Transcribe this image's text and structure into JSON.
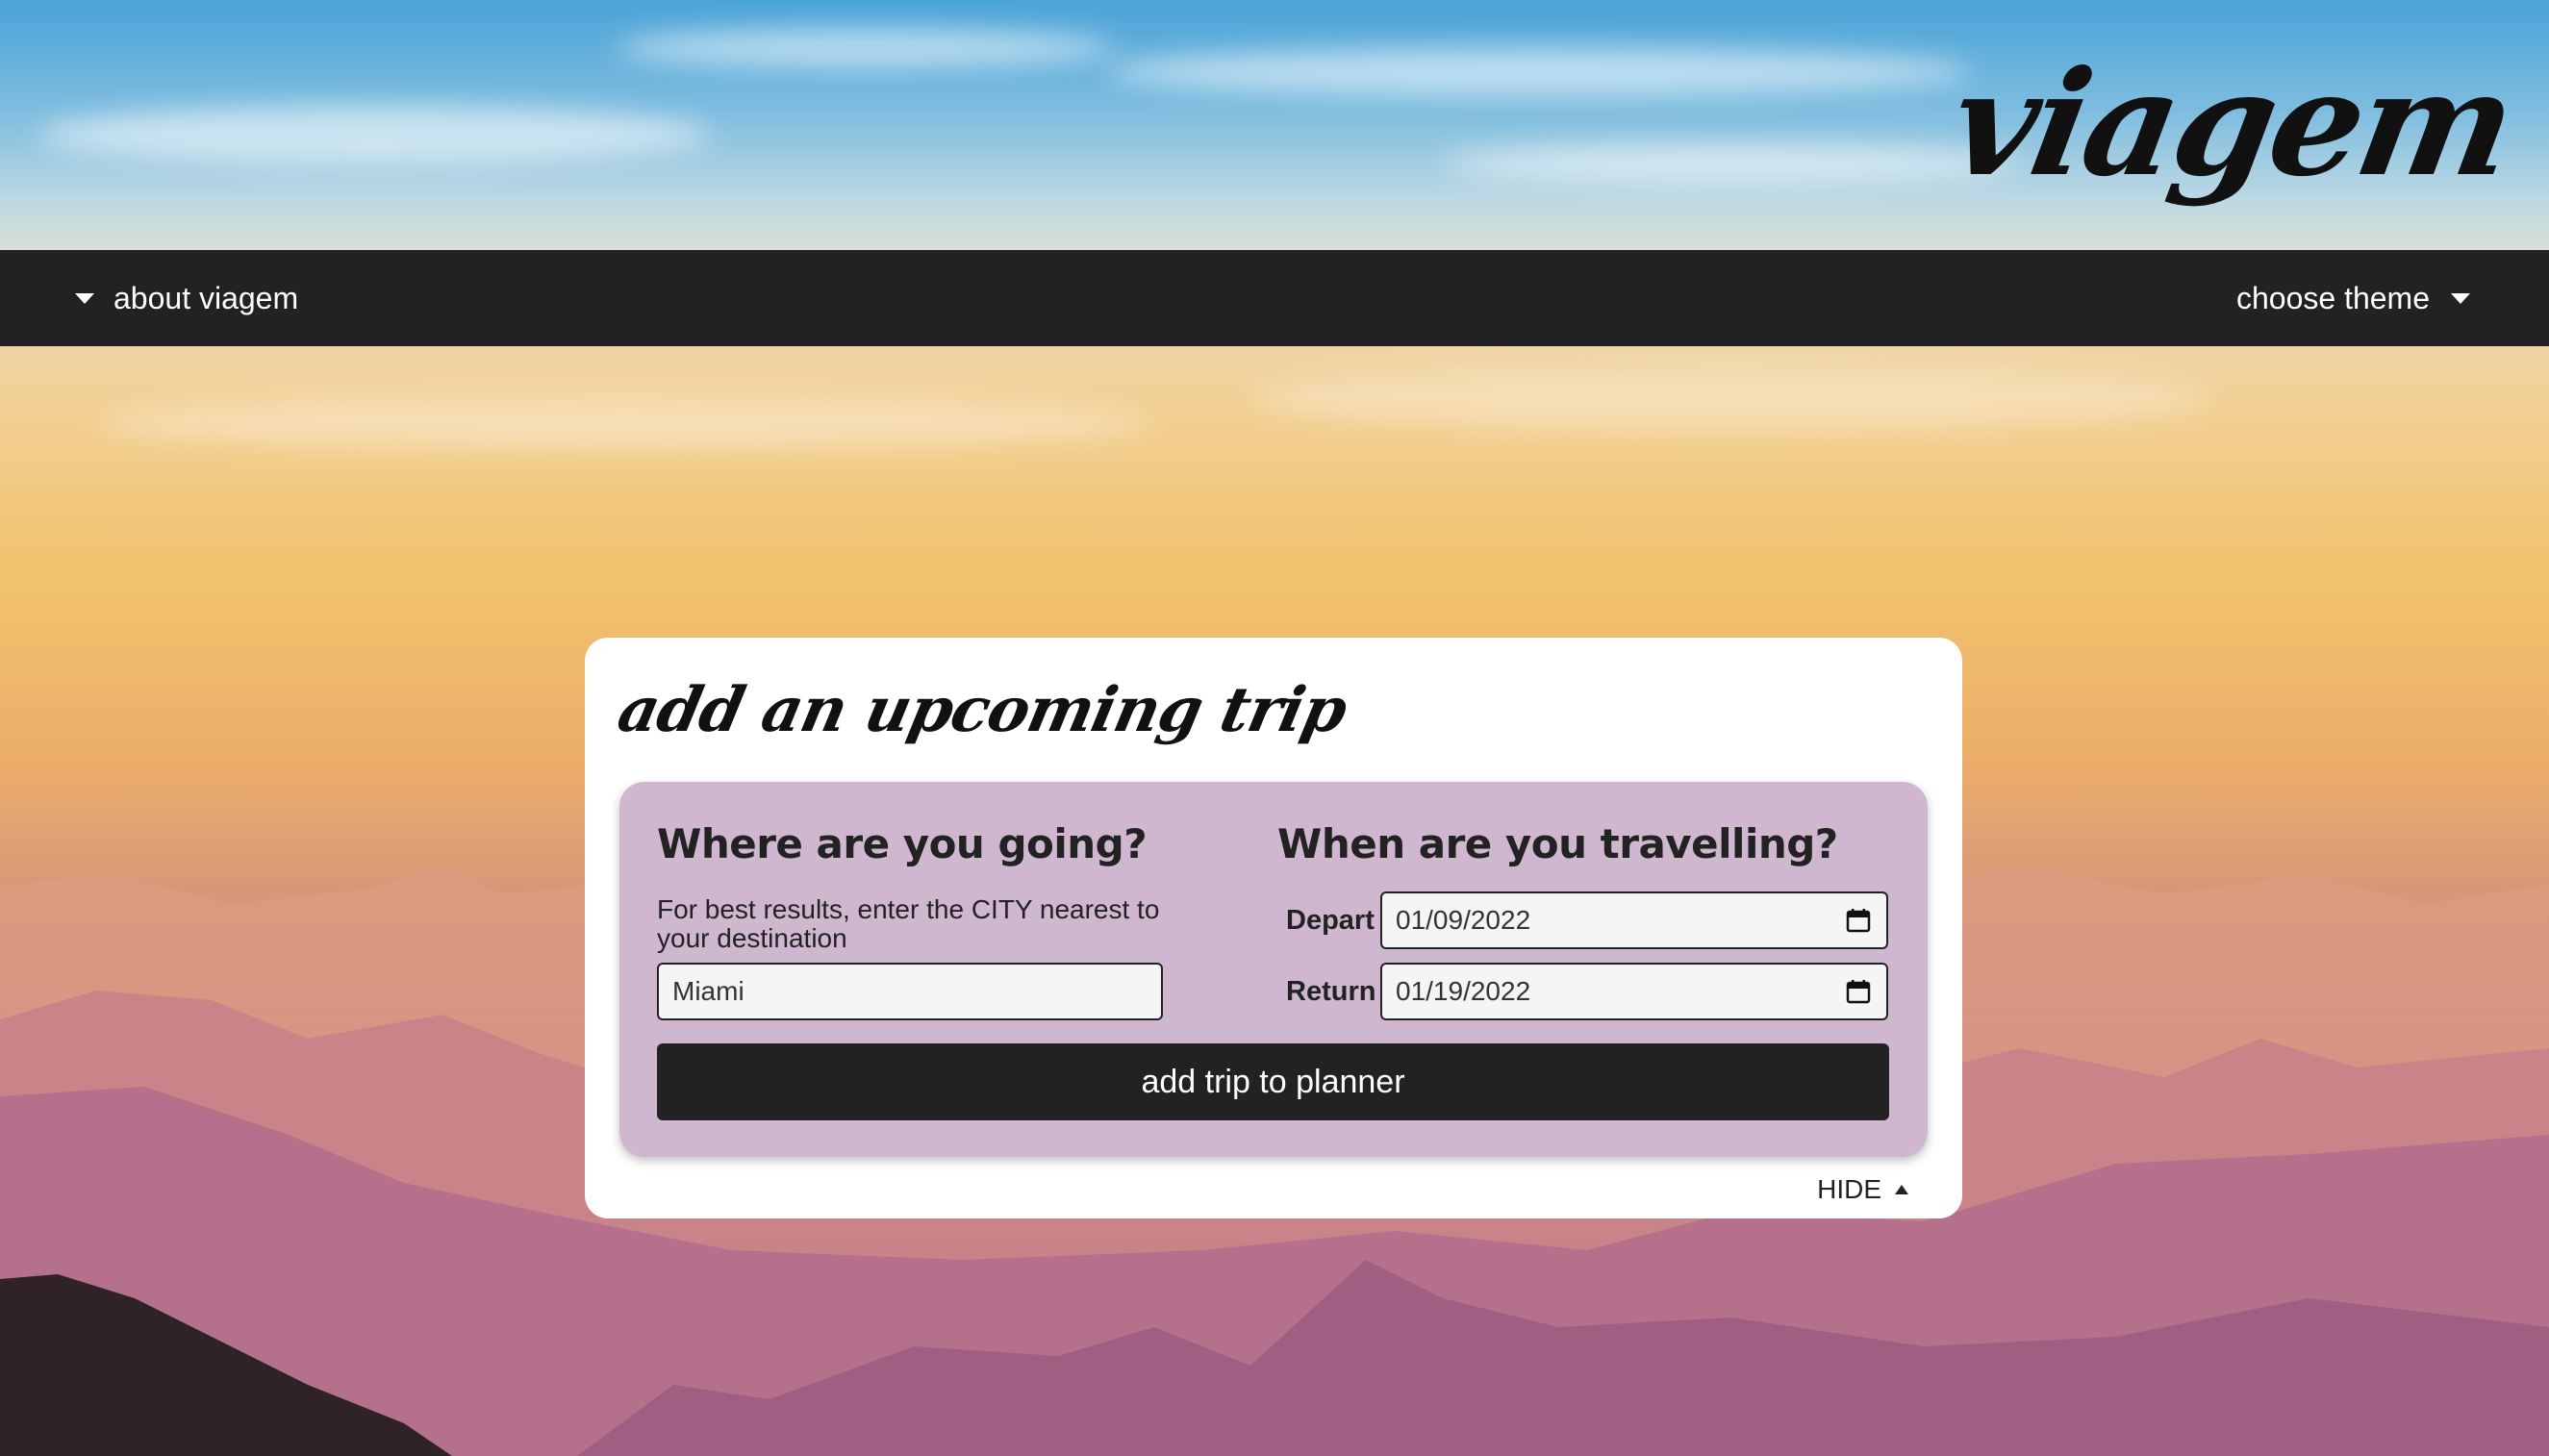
{
  "app": {
    "logo_text": "viagem"
  },
  "nav": {
    "about_label": "about viagem",
    "theme_label": "choose theme"
  },
  "card": {
    "title": "add an upcoming trip",
    "where_heading": "Where are you going?",
    "where_hint": "For best results, enter the CITY nearest to your destination",
    "destination_value": "Miami",
    "when_heading": "When are you travelling?",
    "depart_label": "Depart",
    "depart_value": "01/09/2022",
    "return_label": "Return",
    "return_value": "01/19/2022",
    "submit_label": "add trip to planner",
    "hide_label": "HIDE"
  },
  "colors": {
    "navbar": "#222222",
    "form_panel": "#cfb7cf",
    "button": "#222222"
  },
  "icons": [
    "chevron-down-icon",
    "calendar-icon",
    "chevron-up-icon"
  ]
}
